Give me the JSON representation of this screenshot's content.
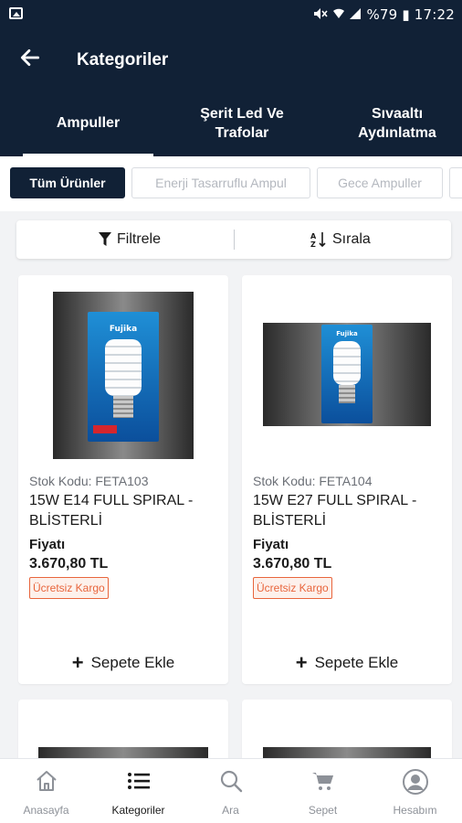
{
  "status_bar": {
    "right_text": "%79 ▮ 17:22",
    "signal_icons": "mute, wifi, signal, battery"
  },
  "header": {
    "title": "Kategoriler"
  },
  "tabs": [
    {
      "label": "Ampuller",
      "active": true
    },
    {
      "label": "Şerit Led Ve Trafolar",
      "line1": "Şerit Led Ve",
      "line2": "Trafolar",
      "active": false
    },
    {
      "label": "Sıvaaltı Aydınlatma",
      "line1": "Sıvaaltı",
      "line2": "Aydınlatma",
      "active": false
    }
  ],
  "chips": [
    {
      "label": "Tüm Ürünler",
      "active": true
    },
    {
      "label": "Enerji Tasarruflu Ampul",
      "active": false
    },
    {
      "label": "Gece Ampuller",
      "active": false
    }
  ],
  "toolbar": {
    "filter_label": "Filtrele",
    "sort_label": "Sırala"
  },
  "products": [
    {
      "stock_code": "Stok Kodu: FETA103",
      "name": "15W E14 FULL SPIRAL - BLİSTERLİ",
      "price_label": "Fiyatı",
      "price": "3.670,80 TL",
      "badge": "Ücretsiz Kargo",
      "add_to_cart": "Sepete Ekle"
    },
    {
      "stock_code": "Stok Kodu: FETA104",
      "name": "15W E27 FULL SPIRAL - BLİSTERLİ",
      "price_label": "Fiyatı",
      "price": "3.670,80 TL",
      "badge": "Ücretsiz Kargo",
      "add_to_cart": "Sepete Ekle"
    }
  ],
  "bottom_nav": [
    {
      "label": "Anasayfa",
      "icon": "home-icon",
      "active": false
    },
    {
      "label": "Kategoriler",
      "icon": "list-icon",
      "active": true
    },
    {
      "label": "Ara",
      "icon": "search-icon",
      "active": false
    },
    {
      "label": "Sepet",
      "icon": "cart-icon",
      "active": false
    },
    {
      "label": "Hesabım",
      "icon": "account-icon",
      "active": false
    }
  ],
  "colors": {
    "primary": "#112136",
    "badge": "#e8653c",
    "background": "#f2f3f5"
  }
}
